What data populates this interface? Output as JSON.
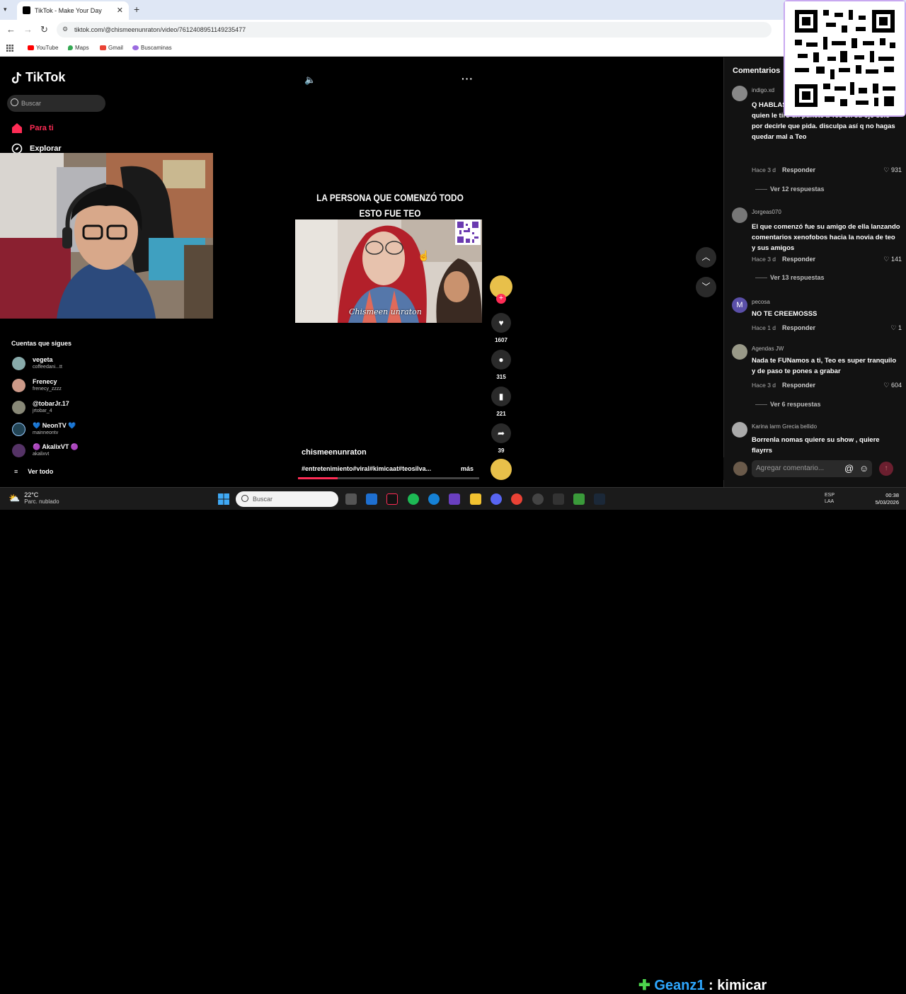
{
  "browser": {
    "tab_title": "TikTok - Make Your Day",
    "tab_close": "✕",
    "new_tab": "+",
    "url": "tiktok.com/@chismeenunraton/video/7612408951149235477",
    "bookmarks": [
      "YouTube",
      "Maps",
      "Gmail",
      "Buscaminas"
    ]
  },
  "sidebar": {
    "logo": "TikTok",
    "search_placeholder": "Buscar",
    "nav": [
      {
        "label": "Para ti"
      },
      {
        "label": "Explorar"
      }
    ],
    "following_title": "Cuentas que sigues",
    "accounts": [
      {
        "name": "vegeta",
        "handle": "coffeedani...tt",
        "color": "#8aa"
      },
      {
        "name": "Frenecy",
        "handle": "frenecy_zzzz",
        "color": "#c98"
      },
      {
        "name": "@tobarJr.17",
        "handle": "jrtobar_4",
        "color": "#887"
      },
      {
        "name": "💙 NeonTV 💙",
        "handle": "mainneontv",
        "color": "#245"
      },
      {
        "name": "🟣 AkalixVT 🟣",
        "handle": "akalixvt",
        "color": "#536"
      }
    ],
    "see_all": "Ver todo"
  },
  "video": {
    "caption_line1": "LA PERSONA QUE COMENZÓ TODO",
    "caption_line2": "ESTO FUE TEO",
    "watermark": "Chismeen unraton",
    "author": "chismeenunraton",
    "tags": "#entretenimiento#viral#kimicaat#teosilva...",
    "more": "más",
    "progress": 0.22,
    "likes": "1607",
    "comments": "315",
    "saves": "221",
    "shares": "39"
  },
  "comments": {
    "title": "Comentarios",
    "items": [
      {
        "user": "indigo.xd",
        "text": "Q HABLAS... comenzó ... xenofóbicos y fue él quien le tiró un puñete a Teo en su ojo solo por decirle que pida. disculpa así q no hagas quedar mal a Teo",
        "time": "Hace 3 d",
        "reply": "Responder",
        "likes": "931",
        "more": "Ver 12 respuestas",
        "color": "#888"
      },
      {
        "user": "Jorgeas070",
        "text": "El que comenzó fue su amigo de ella lanzando comentarios xenofobos hacia la novia de teo y sus amigos",
        "time": "Hace 3 d",
        "reply": "Responder",
        "likes": "141",
        "more": "Ver 13 respuestas",
        "color": "#777"
      },
      {
        "user": "pecosa",
        "text": "NO TE CREEMOSSS",
        "time": "Hace 1 d",
        "reply": "Responder",
        "likes": "1",
        "more": "",
        "color": "#5a4fa8",
        "initial": "M"
      },
      {
        "user": "Agendas JW",
        "text": "Nada te FUNamos a ti, Teo es super tranquilo y de paso te pones a grabar",
        "time": "Hace 3 d",
        "reply": "Responder",
        "likes": "604",
        "more": "Ver 6 respuestas",
        "color": "#998"
      },
      {
        "user": "Karina larm Grecia bellido",
        "text": "Borrenla nomas quiere su show , quiere flayrrs",
        "time": "",
        "reply": "",
        "likes": "",
        "more": "",
        "color": "#aaa"
      }
    ],
    "input_placeholder": "Agregar comentario...",
    "at": "@",
    "emoji": "☺"
  },
  "taskbar": {
    "temp": "22°C",
    "weather": "Parc. nublado",
    "search": "Buscar",
    "overlay_name": "Geanz1",
    "overlay_sep": ":",
    "overlay_text": "kimicar",
    "lang1": "ESP",
    "lang2": "LAA",
    "time": "00:38",
    "date": "5/03/2026"
  }
}
